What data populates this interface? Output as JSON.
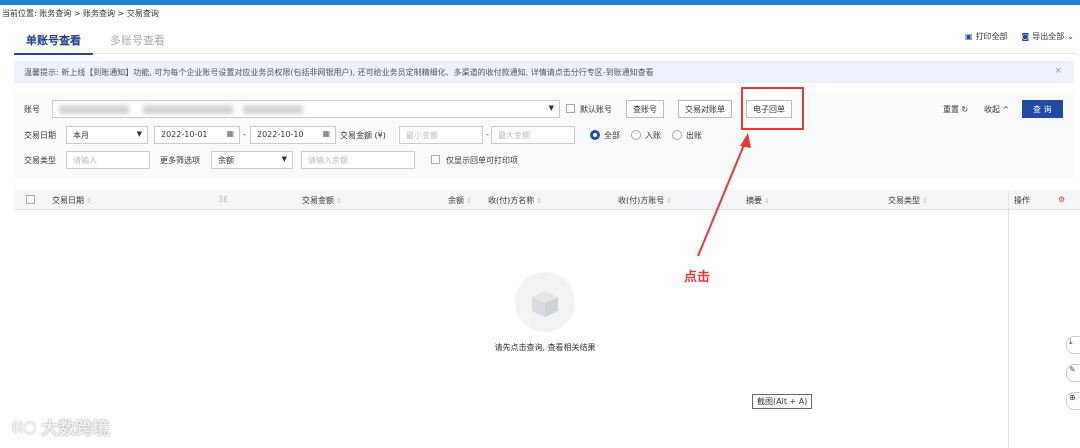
{
  "breadcrumb": "当前位置: 账务查询 > 账务查询 > 交易查询",
  "tabs": [
    {
      "label": "单账号查看",
      "active": true
    },
    {
      "label": "多账号查看",
      "active": false
    }
  ],
  "top_actions": {
    "print_all": "打印全部",
    "export_all": "导出全部"
  },
  "notice": {
    "text": "温馨提示: 新上线【到账通知】功能, 可为每个企业账号设置对应业务员权限(包括非网银用户), 还可给业务员定制精细化、多渠道的收付款通知, 详情请点击分行专区-到账通知查看",
    "close": "×"
  },
  "filters": {
    "account_label": "账号",
    "default_account_label": "默认账号",
    "query_account_btn": "查账号",
    "reconcile_btn": "交易对账单",
    "e_receipt_btn": "电子回单",
    "reset": "重置 ↻",
    "collapse": "收起 ^",
    "search_btn": "查 询",
    "date_label": "交易日期",
    "date_range_value": "本月",
    "date_from": "2022-10-01",
    "date_to": "2022-10-10",
    "date_sep": "-",
    "amount_label": "交易金额 (¥)",
    "amount_min_placeholder": "最小金额",
    "amount_max_placeholder": "最大金额",
    "amount_sep": "-",
    "direction_options": [
      "全部",
      "入账",
      "出账"
    ],
    "direction_selected": "全部",
    "type_label": "交易类型",
    "type_placeholder": "请输入",
    "more_label": "更多筛选项",
    "more_value": "余额",
    "balance_placeholder": "请输入余额",
    "printable_only_label": "仅显示回单可打印项"
  },
  "table": {
    "columns": [
      "交易日期",
      "3E",
      "交易金额",
      "余额",
      "收(付)方名称",
      "收(付)方账号",
      "摘要",
      "交易类型",
      "操作"
    ],
    "empty_text": "请先点击查询, 查看相关结果"
  },
  "annotation": {
    "label": "点击",
    "color": "#e53935"
  },
  "tooltip": "截图(Alt + A)",
  "watermark": "大数跨境",
  "colors": {
    "primary": "#1f4ba6",
    "topbar": "#1f7fd6",
    "notice_bg": "#eef0fb",
    "highlight": "#e53935"
  }
}
